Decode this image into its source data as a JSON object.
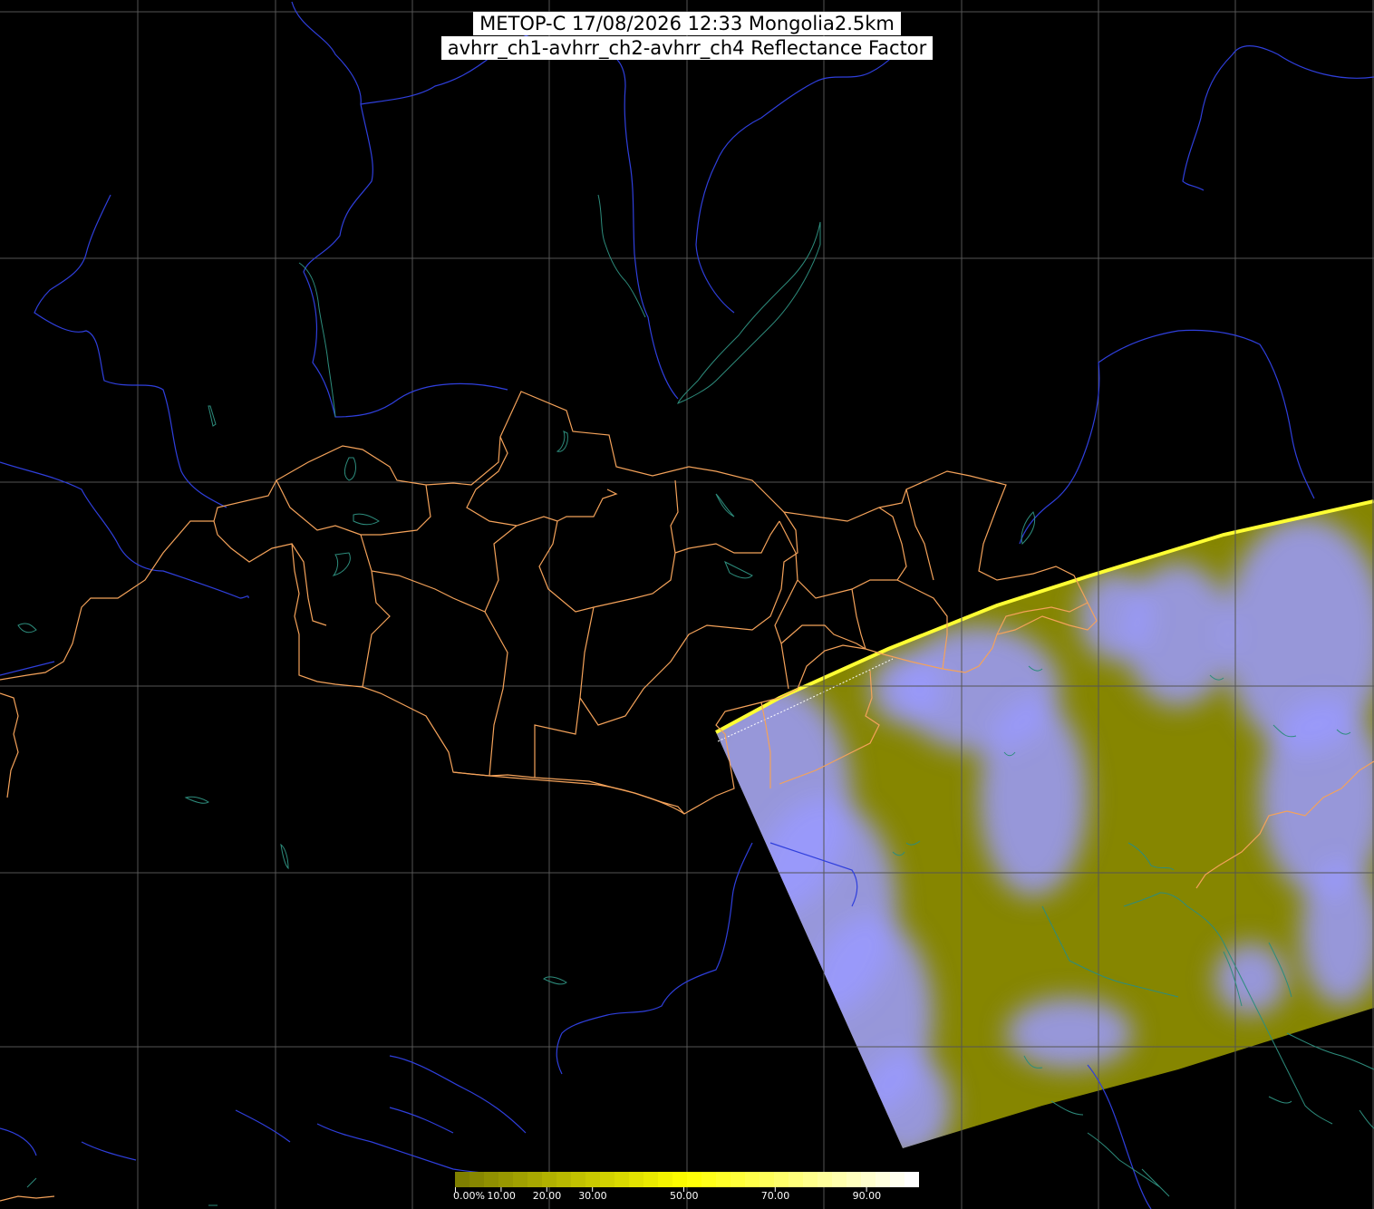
{
  "title": {
    "line1": "METOP-C 17/08/2026 12:33 Mongolia2.5km",
    "line2": "avhrr_ch1-avhrr_ch2-avhrr_ch4 Reflectance Factor"
  },
  "colorbar": {
    "tick_labels": [
      "0.00%",
      "10.00",
      "20.00",
      "30.00",
      "50.00",
      "70.00",
      "90.00"
    ],
    "tick_values": [
      0,
      10,
      20,
      30,
      50,
      70,
      90
    ],
    "max_value": 100,
    "colors": [
      "#7f7f00",
      "#ffff00",
      "#ffffff"
    ]
  },
  "colors": {
    "background": "#000000",
    "graticule": "#555555",
    "coastline": "#2d8c7c",
    "rivers": "#2f3fdc",
    "admin_borders": "#f4a25a",
    "swath_clear": "#868600",
    "swath_cloud": "#9a9aff",
    "swath_edge": "#ffff33"
  }
}
